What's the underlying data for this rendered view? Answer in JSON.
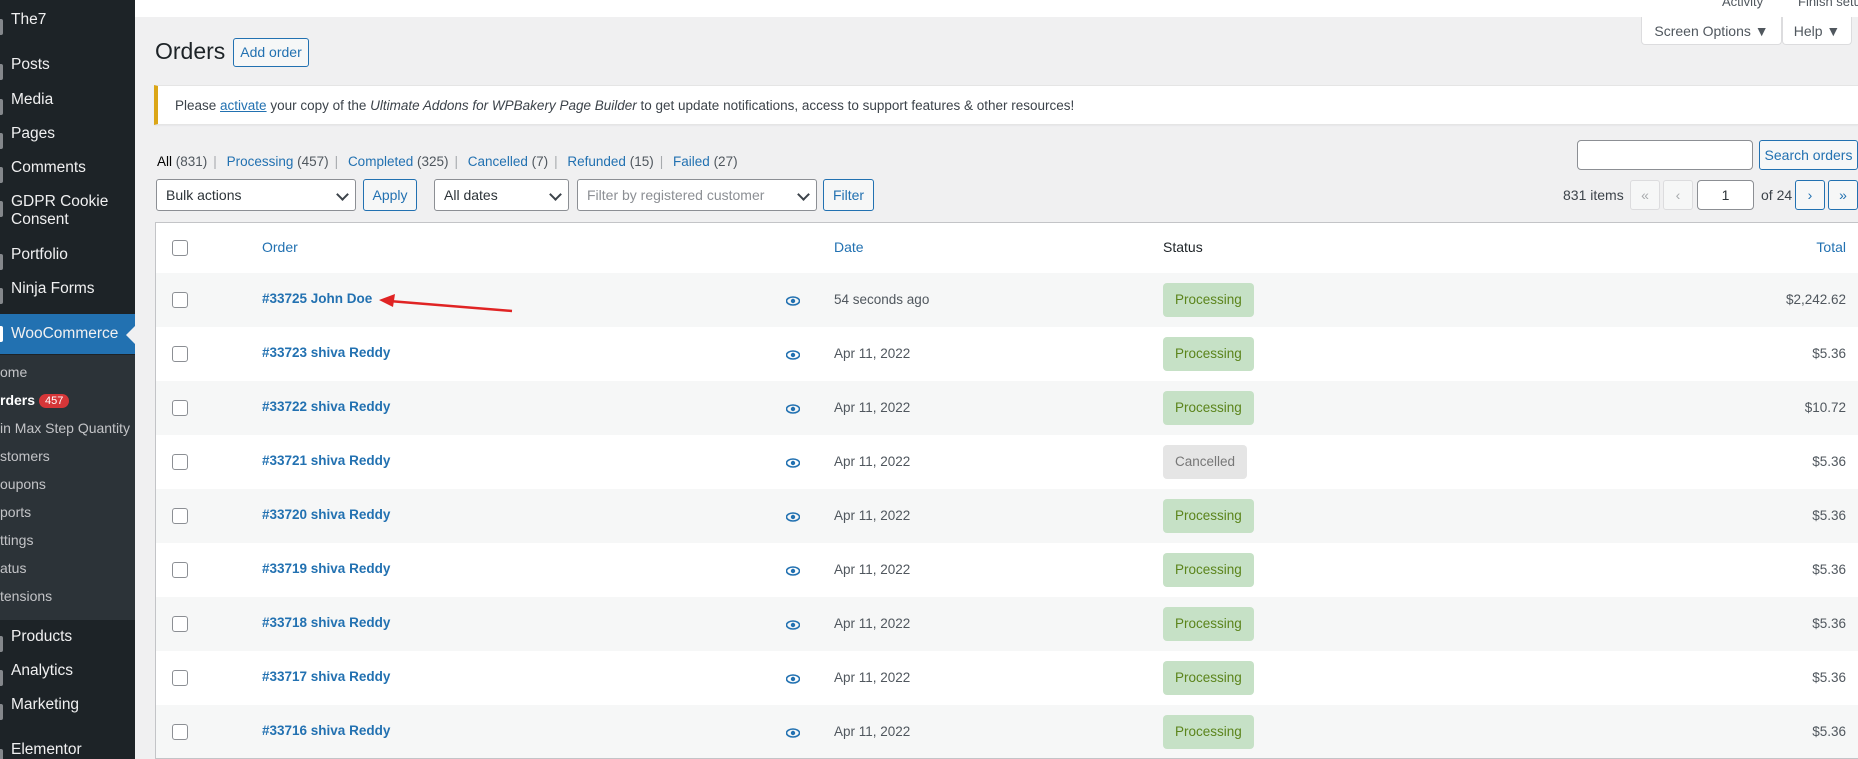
{
  "sidebar": {
    "items": [
      {
        "label": "The7"
      },
      {
        "label": "Posts"
      },
      {
        "label": "Media"
      },
      {
        "label": "Pages"
      },
      {
        "label": "Comments"
      },
      {
        "label": "GDPR Cookie"
      },
      {
        "label": "Consent"
      },
      {
        "label": "Portfolio"
      },
      {
        "label": "Ninja Forms"
      },
      {
        "label": "WooCommerce"
      },
      {
        "label": "Products"
      },
      {
        "label": "Analytics"
      },
      {
        "label": "Marketing"
      },
      {
        "label": "Elementor"
      }
    ],
    "submenu": [
      {
        "label": "ome"
      },
      {
        "label": "rders",
        "badge": "457"
      },
      {
        "label": "in Max Step Quantity"
      },
      {
        "label": "stomers"
      },
      {
        "label": "oupons"
      },
      {
        "label": "ports"
      },
      {
        "label": "ttings"
      },
      {
        "label": "atus"
      },
      {
        "label": "tensions"
      }
    ]
  },
  "topbar": {
    "activity": "Activity",
    "finish_setup": "Finish setu",
    "screen_options": "Screen Options ▼",
    "help": "Help ▼"
  },
  "page": {
    "title": "Orders",
    "add_order": "Add order"
  },
  "notice": {
    "before": "Please ",
    "link": "activate",
    "middle": " your copy of the ",
    "product": "Ultimate Addons for WPBakery Page Builder",
    "after": " to get update notifications, access to support features & other resources!"
  },
  "views": [
    {
      "label": "All",
      "count": "(831)"
    },
    {
      "label": "Processing",
      "count": "(457)"
    },
    {
      "label": "Completed",
      "count": "(325)"
    },
    {
      "label": "Cancelled",
      "count": "(7)"
    },
    {
      "label": "Refunded",
      "count": "(15)"
    },
    {
      "label": "Failed",
      "count": "(27)"
    }
  ],
  "filters": {
    "bulk_actions": "Bulk actions",
    "apply": "Apply",
    "all_dates": "All dates",
    "customer_placeholder": "Filter by registered customer",
    "filter": "Filter",
    "search_button": "Search orders"
  },
  "pagination": {
    "items": "831 items",
    "first": "«",
    "prev": "‹",
    "current": "1",
    "of": "of 24",
    "next": "›",
    "last": "»"
  },
  "table": {
    "headers": {
      "order": "Order",
      "date": "Date",
      "status": "Status",
      "total": "Total"
    },
    "rows": [
      {
        "order": "#33725 John Doe",
        "date": "54 seconds ago",
        "status": "Processing",
        "total": "$2,242.62"
      },
      {
        "order": "#33723 shiva Reddy",
        "date": "Apr 11, 2022",
        "status": "Processing",
        "total": "$5.36"
      },
      {
        "order": "#33722 shiva Reddy",
        "date": "Apr 11, 2022",
        "status": "Processing",
        "total": "$10.72"
      },
      {
        "order": "#33721 shiva Reddy",
        "date": "Apr 11, 2022",
        "status": "Cancelled",
        "total": "$5.36"
      },
      {
        "order": "#33720 shiva Reddy",
        "date": "Apr 11, 2022",
        "status": "Processing",
        "total": "$5.36"
      },
      {
        "order": "#33719 shiva Reddy",
        "date": "Apr 11, 2022",
        "status": "Processing",
        "total": "$5.36"
      },
      {
        "order": "#33718 shiva Reddy",
        "date": "Apr 11, 2022",
        "status": "Processing",
        "total": "$5.36"
      },
      {
        "order": "#33717 shiva Reddy",
        "date": "Apr 11, 2022",
        "status": "Processing",
        "total": "$5.36"
      },
      {
        "order": "#33716 shiva Reddy",
        "date": "Apr 11, 2022",
        "status": "Processing",
        "total": "$5.36"
      }
    ]
  },
  "colors": {
    "sidebar_bg": "#1d2327",
    "accent": "#2271b1",
    "processing_bg": "#c6e1c6",
    "processing_text": "#5b841b",
    "cancelled_bg": "#e5e5e5",
    "annotation_arrow": "#e02424"
  }
}
